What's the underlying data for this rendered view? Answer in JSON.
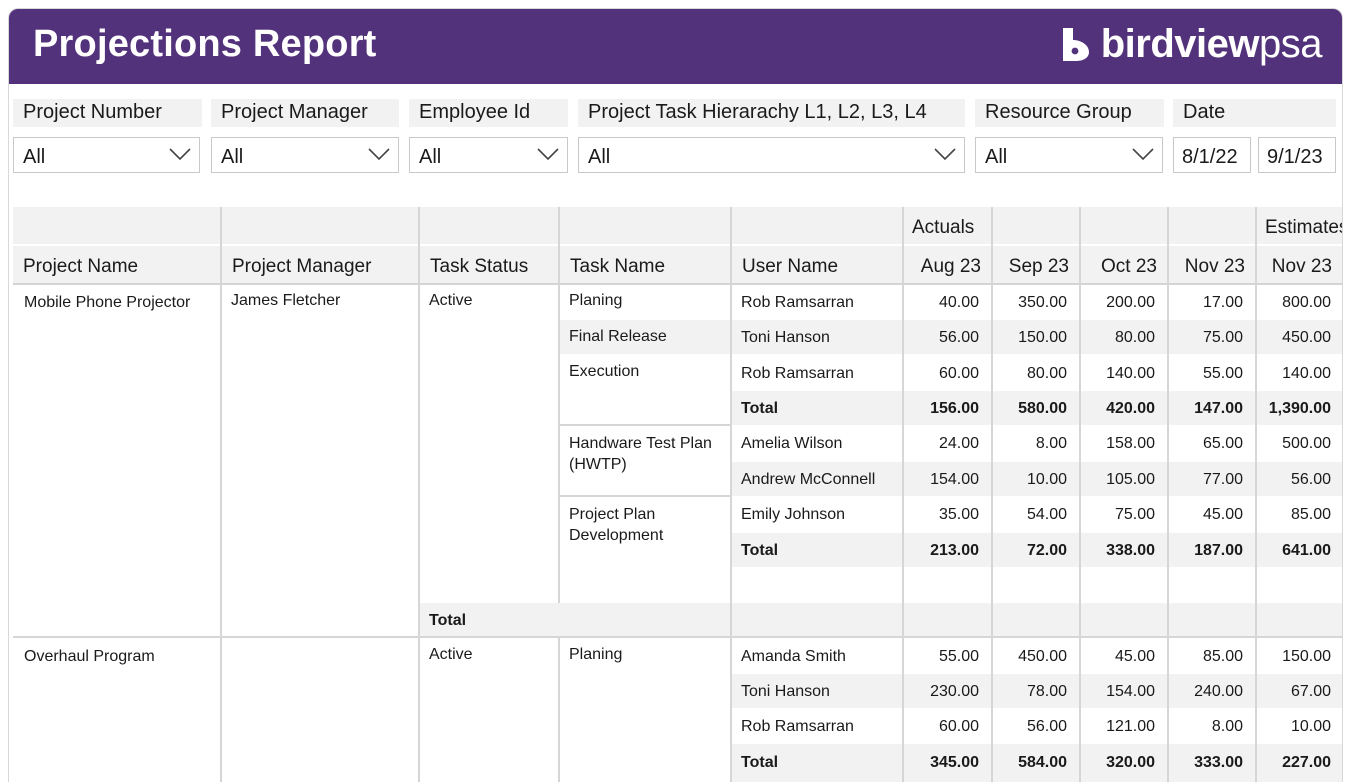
{
  "header": {
    "title": "Projections Report",
    "logo": {
      "bold": "birdview",
      "light": "psa",
      "icon": "birdview-logo-icon"
    }
  },
  "filters": [
    {
      "label": "Project Number",
      "value": "All"
    },
    {
      "label": "Project Manager",
      "value": "All"
    },
    {
      "label": "Employee Id",
      "value": "All"
    },
    {
      "label": "Project Task Hierarachy L1, L2, L3, L4",
      "value": "All"
    },
    {
      "label": "Resource Group",
      "value": "All"
    }
  ],
  "date_filter": {
    "label": "Date",
    "from": "8/1/22",
    "to": "9/1/23"
  },
  "table": {
    "groups": {
      "actuals": "Actuals",
      "estimates": "Estimates"
    },
    "columns": [
      "Project Name",
      "Project Manager",
      "Task Status",
      "Task Name",
      "User Name",
      "Aug 23",
      "Sep 23",
      "Oct 23",
      "Nov 23",
      "Nov 23"
    ],
    "projects": [
      {
        "name": "Mobile Phone Projector",
        "manager": "James Fletcher",
        "status": "Active",
        "status_total": "Total"
      },
      {
        "name": "Overhaul Program",
        "manager": "",
        "status": "Active"
      }
    ],
    "tasks": [
      "Planing",
      "Final Release",
      "Execution",
      "Handware Test Plan (HWTP)",
      "Project Plan Development",
      "Planing"
    ],
    "rows": [
      {
        "user": "Rob Ramsarran",
        "values": [
          "40.00",
          "350.00",
          "200.00",
          "17.00",
          "800.00"
        ]
      },
      {
        "user": "Toni Hanson",
        "values": [
          "56.00",
          "150.00",
          "80.00",
          "75.00",
          "450.00"
        ]
      },
      {
        "user": "Rob Ramsarran",
        "values": [
          "60.00",
          "80.00",
          "140.00",
          "55.00",
          "140.00"
        ]
      },
      {
        "user": "Total",
        "values": [
          "156.00",
          "580.00",
          "420.00",
          "147.00",
          "1,390.00"
        ]
      },
      {
        "user": "Amelia Wilson",
        "values": [
          "24.00",
          "8.00",
          "158.00",
          "65.00",
          "500.00"
        ]
      },
      {
        "user": "Andrew McConnell",
        "values": [
          "154.00",
          "10.00",
          "105.00",
          "77.00",
          "56.00"
        ]
      },
      {
        "user": "Emily Johnson",
        "values": [
          "35.00",
          "54.00",
          "75.00",
          "45.00",
          "85.00"
        ]
      },
      {
        "user": "Total",
        "values": [
          "213.00",
          "72.00",
          "338.00",
          "187.00",
          "641.00"
        ]
      },
      {
        "user": "Amanda Smith",
        "values": [
          "55.00",
          "450.00",
          "45.00",
          "85.00",
          "150.00"
        ]
      },
      {
        "user": "Toni Hanson",
        "values": [
          "230.00",
          "78.00",
          "154.00",
          "240.00",
          "67.00"
        ]
      },
      {
        "user": "Rob Ramsarran",
        "values": [
          "60.00",
          "56.00",
          "121.00",
          "8.00",
          "10.00"
        ]
      },
      {
        "user": "Total",
        "values": [
          "345.00",
          "584.00",
          "320.00",
          "333.00",
          "227.00"
        ]
      }
    ]
  },
  "colors": {
    "header_bg": "#53327c",
    "header_text": "#ffffff",
    "cell_shade": "#f2f2f2"
  }
}
